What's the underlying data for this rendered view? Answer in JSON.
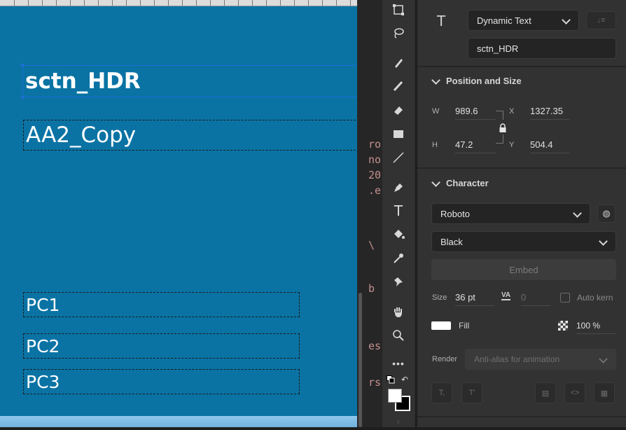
{
  "canvas": {
    "fields": {
      "header": "sctn_HDR",
      "copy": "AA2_Copy",
      "pc1": "PC1",
      "pc2": "PC2",
      "pc3": "PC3"
    },
    "side_text": [
      "ro",
      "no",
      "20",
      ".e",
      "\\",
      "b",
      "es",
      "rs"
    ]
  },
  "properties": {
    "text_type": "Dynamic Text",
    "instance_name": "sctn_HDR",
    "position_size": {
      "title": "Position and Size",
      "w_label": "W",
      "w_value": "989.6",
      "h_label": "H",
      "h_value": "47.2",
      "x_label": "X",
      "x_value": "1327.35",
      "y_label": "Y",
      "y_value": "504.4"
    },
    "character": {
      "title": "Character",
      "font_family": "Roboto",
      "font_style": "Black",
      "embed_label": "Embed",
      "size_label": "Size",
      "size_value": "36 pt",
      "tracking_value": "0",
      "auto_kern_label": "Auto kern",
      "fill_label": "Fill",
      "alpha_value": "100 %",
      "render_label": "Render",
      "render_value": "Anti-alias for animation",
      "fill_color": "#ffffff"
    }
  },
  "colors": {
    "stage": "#0a73a4",
    "panel": "#323232",
    "accent": "#1a73e8"
  }
}
